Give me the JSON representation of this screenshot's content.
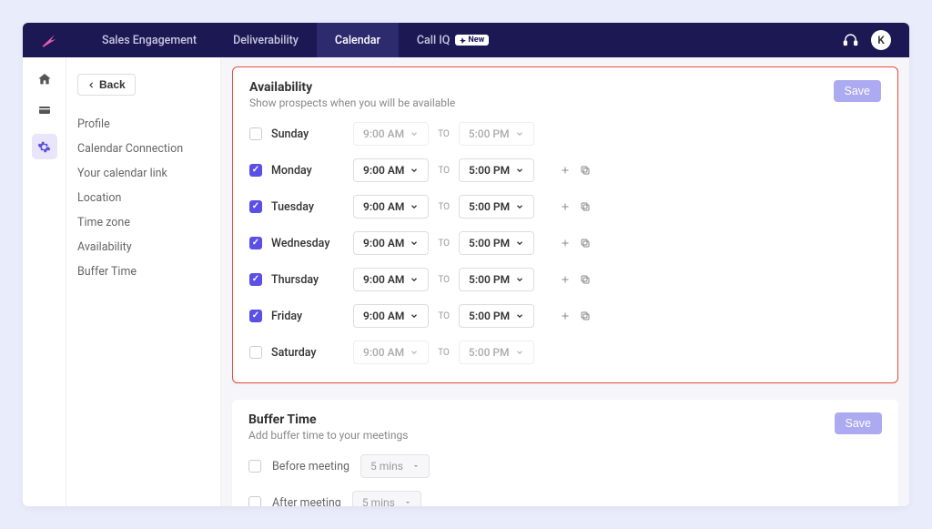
{
  "nav": {
    "items": [
      "Sales Engagement",
      "Deliverability",
      "Calendar",
      "Call IQ"
    ],
    "new_badge": "New",
    "avatar_letter": "K"
  },
  "sidebar": {
    "back": "Back",
    "items": [
      "Profile",
      "Calendar Connection",
      "Your calendar link",
      "Location",
      "Time zone",
      "Availability",
      "Buffer Time"
    ]
  },
  "availability": {
    "title": "Availability",
    "subtitle": "Show prospects when you will be available",
    "save": "Save",
    "to_label": "TO",
    "days": [
      {
        "name": "Sunday",
        "checked": false,
        "start": "9:00 AM",
        "end": "5:00 PM",
        "actions": false
      },
      {
        "name": "Monday",
        "checked": true,
        "start": "9:00 AM",
        "end": "5:00 PM",
        "actions": true
      },
      {
        "name": "Tuesday",
        "checked": true,
        "start": "9:00 AM",
        "end": "5:00 PM",
        "actions": true
      },
      {
        "name": "Wednesday",
        "checked": true,
        "start": "9:00 AM",
        "end": "5:00 PM",
        "actions": true
      },
      {
        "name": "Thursday",
        "checked": true,
        "start": "9:00 AM",
        "end": "5:00 PM",
        "actions": true
      },
      {
        "name": "Friday",
        "checked": true,
        "start": "9:00 AM",
        "end": "5:00 PM",
        "actions": true
      },
      {
        "name": "Saturday",
        "checked": false,
        "start": "9:00 AM",
        "end": "5:00 PM",
        "actions": false
      }
    ]
  },
  "buffer": {
    "title": "Buffer Time",
    "subtitle": "Add buffer time to your meetings",
    "save": "Save",
    "before_label": "Before meeting",
    "before_value": "5 mins",
    "after_label": "After meeting",
    "after_value": "5 mins"
  }
}
